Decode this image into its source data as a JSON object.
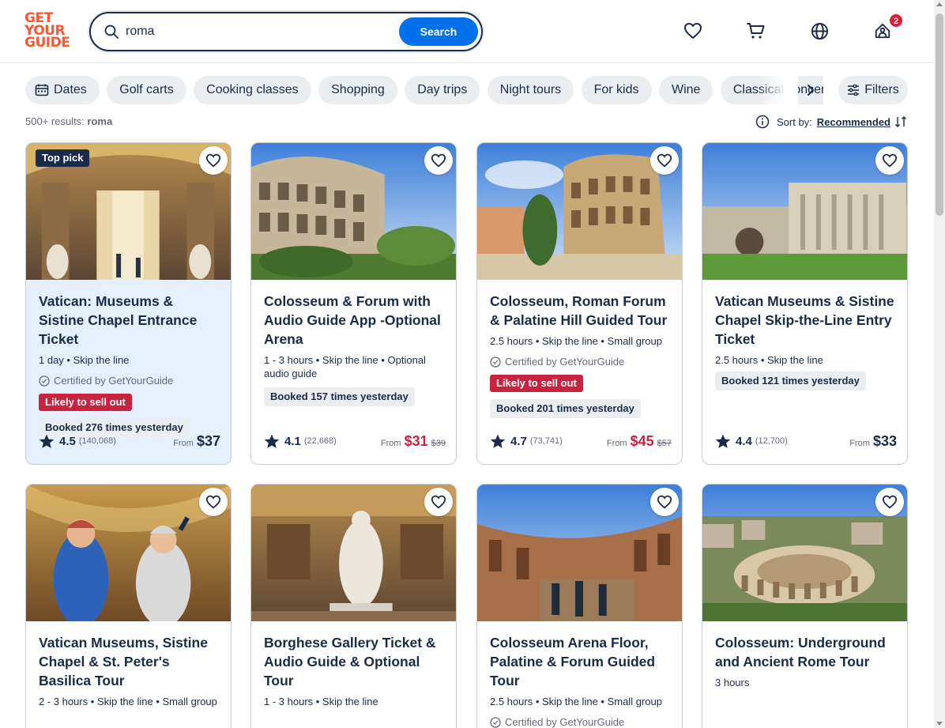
{
  "logo": {
    "line1": "GET",
    "line2": "YOUR",
    "line3": "GUIDE"
  },
  "search": {
    "value": "roma",
    "button": "Search"
  },
  "header": {
    "cart_badge": "2"
  },
  "chips": [
    "Dates",
    "Golf carts",
    "Cooking classes",
    "Shopping",
    "Day trips",
    "Night tours",
    "For kids",
    "Wine",
    "Classical concerts"
  ],
  "filters_label": "Filters",
  "results": {
    "count": "500+ results:",
    "query": "roma"
  },
  "sort": {
    "label": "Sort by:",
    "value": "Recommended"
  },
  "colors": {
    "brand": "#ff5533",
    "accent": "#0071eb",
    "sale": "#c9243f",
    "navy": "#1a2b49"
  },
  "cards": [
    {
      "tag": "Top pick",
      "title": "Vatican: Museums & Sistine Chapel Entrance Ticket",
      "meta": "1 day • Skip the line",
      "certified": "Certified by GetYourGuide",
      "sell": "Likely to sell out",
      "booked": "Booked 276 times yesterday",
      "rating": "4.5",
      "reviews": "(140,068)",
      "from": "From",
      "price": "$37",
      "old_price": ""
    },
    {
      "tag": "",
      "title": "Colosseum & Forum with Audio Guide App -Optional Arena",
      "meta": "1 - 3 hours • Skip the line • Optional audio guide",
      "certified": "",
      "sell": "",
      "booked": "Booked 157 times yesterday",
      "rating": "4.1",
      "reviews": "(22,668)",
      "from": "From",
      "price": "$31",
      "old_price": "$39"
    },
    {
      "tag": "",
      "title": "Colosseum, Roman Forum & Palatine Hill Guided Tour",
      "meta": "2.5 hours • Skip the line • Small group",
      "certified": "Certified by GetYourGuide",
      "sell": "Likely to sell out",
      "booked": "Booked 201 times yesterday",
      "rating": "4.7",
      "reviews": "(73,741)",
      "from": "From",
      "price": "$45",
      "old_price": "$57"
    },
    {
      "tag": "",
      "title": "Vatican Museums & Sistine Chapel Skip-the-Line Entry Ticket",
      "meta": "2.5 hours • Skip the line",
      "certified": "",
      "sell": "",
      "booked": "Booked 121 times yesterday",
      "rating": "4.4",
      "reviews": "(12,700)",
      "from": "From",
      "price": "$33",
      "old_price": ""
    },
    {
      "title": "Vatican Museums, Sistine Chapel & St. Peter's Basilica Tour",
      "meta": "2 - 3 hours • Skip the line • Small group"
    },
    {
      "title": "Borghese Gallery Ticket & Audio Guide & Optional Tour",
      "meta": "1 - 3 hours • Skip the line"
    },
    {
      "title": "Colosseum Arena Floor, Palatine & Forum Guided Tour",
      "meta": "2.5 hours • Skip the line • Small group",
      "certified": "Certified by GetYourGuide"
    },
    {
      "title": "Colosseum: Underground and Ancient Rome Tour",
      "meta": "3 hours"
    }
  ]
}
